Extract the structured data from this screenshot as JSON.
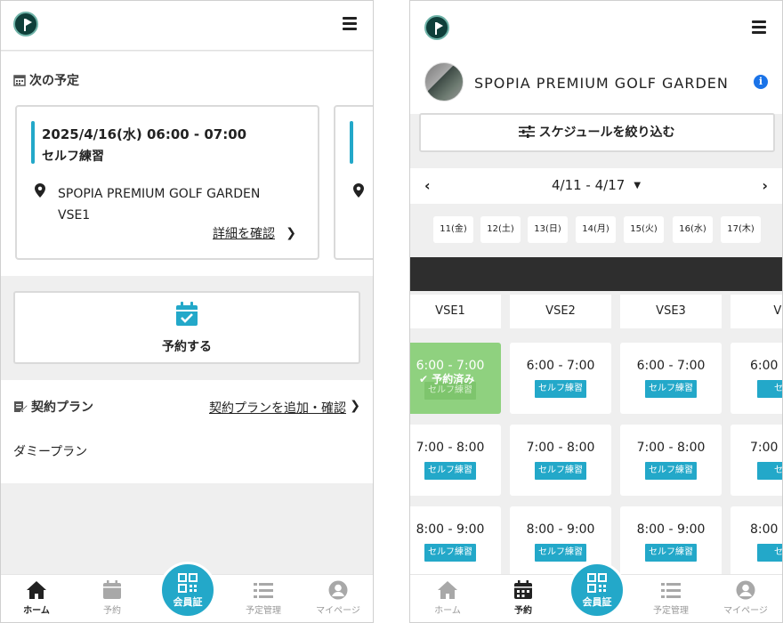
{
  "left": {
    "next_title": "次の予定",
    "card": {
      "datetime": "2025/4/16(水) 06:00 - 07:00",
      "type": "セルフ練習",
      "place_line1": "SPOPIA PREMIUM GOLF GARDEN",
      "place_line2": "VSE1",
      "detail_link": "詳細を確認"
    },
    "reserve_label": "予約する",
    "plan_title": "契約プラン",
    "plan_link": "契約プランを追加・確認",
    "plan_item": "ダミープラン"
  },
  "right": {
    "venue_name": "SPOPIA PREMIUM GOLF GARDEN",
    "filter_label": "スケジュールを絞り込む",
    "week_label": "4/11 - 4/17",
    "days": [
      "11(金)",
      "12(土)",
      "13(日)",
      "14(月)",
      "15(火)",
      "16(水)",
      "17(木)"
    ],
    "columns": [
      "VSE1",
      "VSE2",
      "VSE3",
      "VS"
    ],
    "rows": [
      {
        "time": "6:00 - 7:00",
        "tag": "セルフ練習"
      },
      {
        "time": "7:00 - 8:00",
        "tag": "セルフ練習"
      },
      {
        "time": "8:00 - 9:00",
        "tag": "セルフ練習"
      }
    ],
    "booked_badge": "予約済み",
    "partial_time": "6:00",
    "partial_time2": "7:00",
    "partial_time3": "8:00",
    "partial_tag": "セル"
  },
  "nav": {
    "home": "ホーム",
    "reserve": "予約",
    "member": "会員証",
    "schedule": "予定管理",
    "mypage": "マイページ"
  },
  "colors": {
    "accent": "#23a8c9",
    "booked": "#8fd17f"
  }
}
